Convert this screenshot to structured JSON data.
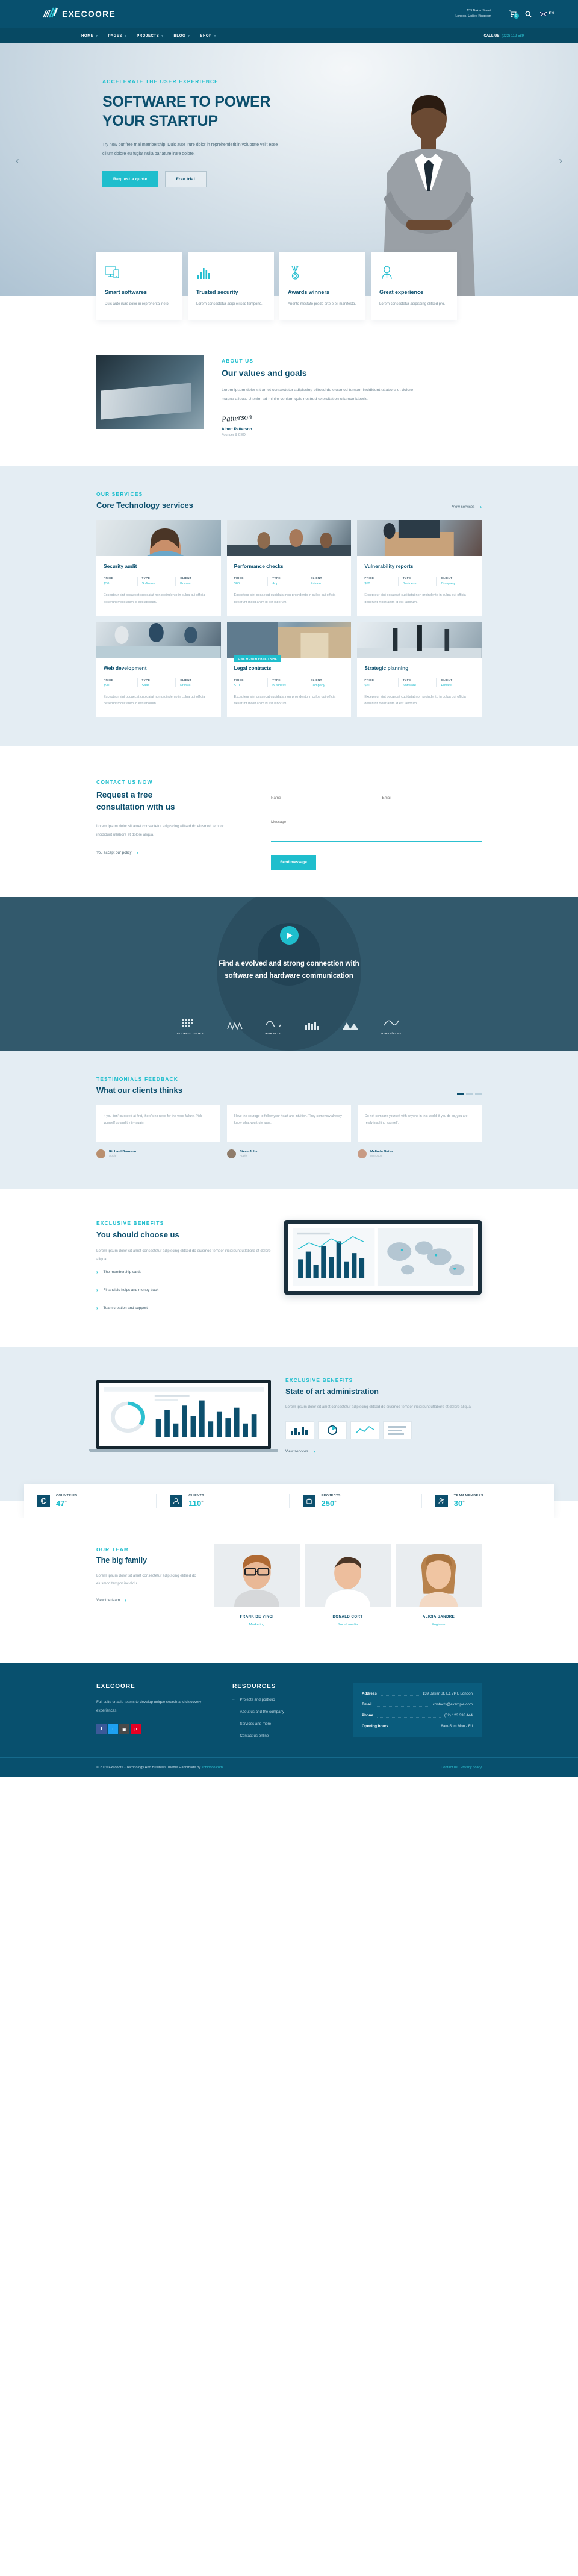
{
  "brand": {
    "name": "EXECOORE"
  },
  "topbar": {
    "address_line1": "139 Baker Street",
    "address_line2": "London, United Kingdom",
    "cart_count": "0",
    "lang": "EN",
    "cart_icon": "cart-icon",
    "search_icon": "search-icon",
    "flag_icon": "uk-flag-icon"
  },
  "nav": {
    "items": [
      {
        "label": "HOME",
        "caret": "▾"
      },
      {
        "label": "PAGES",
        "caret": "▾"
      },
      {
        "label": "PROJECTS",
        "caret": "▾"
      },
      {
        "label": "BLOG",
        "caret": "▾"
      },
      {
        "label": "SHOP",
        "caret": "▾"
      }
    ],
    "call_label": "CALL US:",
    "call_number": "(023) 112 589"
  },
  "hero": {
    "eyebrow": "ACCELERATE THE USER EXPERIENCE",
    "title_line1": "SOFTWARE TO POWER",
    "title_line2": "YOUR STARTUP",
    "paragraph": "Try now our free trial membership. Duis aute irure dolor in reprehenderit in voluptate velit esse cillum dolore eu fugiat nulla pariature irure dolore.",
    "btn_primary": "Request a quote",
    "btn_ghost": "Free trial",
    "arrow_left": "‹",
    "arrow_right": "›"
  },
  "features": [
    {
      "icon": "monitor-mobile-icon",
      "title": "Smart softwares",
      "text": "Duis aute irure dolor in repreherita ineto."
    },
    {
      "icon": "bar-chart-icon",
      "title": "Trusted security",
      "text": "Lorem consectetur adipi elitsed tempono."
    },
    {
      "icon": "medal-icon",
      "title": "Awards winners",
      "text": "Ariento mesfato prodo arte e eli manifesto."
    },
    {
      "icon": "person-tie-icon",
      "title": "Great experience",
      "text": "Lorem consectetur adipiscing elitsed pro."
    }
  ],
  "about": {
    "eyebrow": "ABOUT US",
    "title": "Our values and goals",
    "paragraph": "Lorem ipsum dolor sit amet consectetur adipiscing elitsed do eiusmod tempor incididunt utlabore et dolore magna aliqua. Utenim ad minim veniam quis nostrud exercitation ullamco laboris.",
    "signature": "Patterson",
    "name": "Albert Patterson",
    "role": "Founder & CEO"
  },
  "services": {
    "eyebrow": "OUR SERVICES",
    "title": "Core Technology services",
    "view_link": "View services",
    "chevron": "›",
    "meta_labels": {
      "price": "PRICE",
      "type": "TYPE",
      "client": "CLIENT"
    },
    "cards": [
      {
        "title": "Security audit",
        "price": "$50",
        "type": "Software",
        "client": "Private",
        "text": "Excepteur sint occaecat cupidatat non proindento in culpa qui officia deserunt mollit anim id est laborum.",
        "badge": ""
      },
      {
        "title": "Performance checks",
        "price": "$80",
        "type": "App",
        "client": "Private",
        "text": "Excepteur sint occaecat cupidatat non proindento in culpa qui officia deserunt mollit anim id est laborum.",
        "badge": ""
      },
      {
        "title": "Vulnerability reports",
        "price": "$50",
        "type": "Business",
        "client": "Company",
        "text": "Excepteur sint occaecat cupidatat non proindento in culpa qui officia deserunt mollit anim id est laborum.",
        "badge": ""
      },
      {
        "title": "Web development",
        "price": "$90",
        "type": "Saas",
        "client": "Private",
        "text": "Excepteur sint occaecat cupidatat non proindento in culpa qui officia deserunt mollit anim id est laborum.",
        "badge": ""
      },
      {
        "title": "Legal contracts",
        "price": "$100",
        "type": "Business",
        "client": "Company",
        "text": "Excepteur sint occaecat cupidatat non proindento in culpa qui officia deserunt mollit anim id est laborum.",
        "badge": "ONE MONTH FREE TRIAL"
      },
      {
        "title": "Strategic planning",
        "price": "$50",
        "type": "Software",
        "client": "Private",
        "text": "Excepteur sint occaecat cupidatat non proindento in culpa qui officia deserunt mollit anim id est laborum.",
        "badge": ""
      }
    ]
  },
  "contact": {
    "eyebrow": "CONTACT US NOW",
    "title_line1": "Request a free",
    "title_line2": "consultation with us",
    "paragraph": "Lorem ipsum dolor sit amet consectetur adipiscing elitsed do eiusmod tempor incididunt utlabore et dolore aliqua.",
    "policy": "You accept our policy",
    "chevron": "›",
    "name_placeholder": "Name",
    "email_placeholder": "Email",
    "message_placeholder": "Message",
    "send_label": "Send message"
  },
  "video": {
    "play_icon": "play-icon",
    "title_line1": "Find a evolved and strong connection with",
    "title_line2": "software and hardware communication",
    "brands": [
      {
        "icon": "grid-icon",
        "name": "TECHNOLOGIES"
      },
      {
        "icon": "peaks-icon",
        "name": ""
      },
      {
        "icon": "flow-icon",
        "name": "HOMELIS"
      },
      {
        "icon": "bars-icon",
        "name": ""
      },
      {
        "icon": "mountain-icon",
        "name": ""
      },
      {
        "icon": "wave-icon",
        "name": "Oceanforms"
      }
    ]
  },
  "testimonials": {
    "eyebrow": "TESTIMONIALS FEEDBACK",
    "title": "What our clients thinks",
    "items": [
      {
        "text": "If you don't succeed at first, there's no need for the word failure. Pick yourself up and try try again.",
        "name": "Richard Branson",
        "role": "Apple"
      },
      {
        "text": "Have the courage to follow your heart and intuition. They somehow already know what you truly want.",
        "name": "Steve Jobs",
        "role": "Apple"
      },
      {
        "text": "Do not compare yourself with anyone in this world, if you do so, you are really insulting yourself.",
        "name": "Melinda Gates",
        "role": "Microsoft"
      }
    ]
  },
  "benefits": {
    "eyebrow": "EXCLUSIVE BENEFITS",
    "title": "You should choose us",
    "paragraph": "Lorem ipsum dolor sit amet consectetur adipiscing elitsed do eiusmod tempor incididunt utlabore et dolore aliqua.",
    "chevron": "›",
    "items": [
      "The membership cards",
      "Financials helps and money back",
      "Team creation and support"
    ]
  },
  "admin": {
    "eyebrow": "EXCLUSIVE BENEFITS",
    "title": "State of art administration",
    "paragraph": "Lorem ipsum dolor sit amet consectetur adipiscing elitsed do eiusmod tempor incididunt utlabore et dolore aliqua.",
    "view_link": "View services",
    "chevron": "›"
  },
  "counters": [
    {
      "icon": "globe-icon",
      "label": "COUNTRIES",
      "value": "47",
      "suffix": "+"
    },
    {
      "icon": "user-icon",
      "label": "CLIENTS",
      "value": "110",
      "suffix": "+"
    },
    {
      "icon": "briefcase-icon",
      "label": "PROJECTS",
      "value": "250",
      "suffix": "+"
    },
    {
      "icon": "team-icon",
      "label": "TEAM MEMBERS",
      "value": "30",
      "suffix": "+"
    }
  ],
  "team": {
    "eyebrow": "OUR TEAM",
    "title": "The big family",
    "paragraph": "Lorem ipsum dolor sit amet consectetur adipiscing elitsed do eiusmod tempor incididu.",
    "link": "View the team",
    "chevron": "›",
    "members": [
      {
        "name": "FRANK DE VINCI",
        "role": "Marketing"
      },
      {
        "name": "DONALD CORT",
        "role": "Social media"
      },
      {
        "name": "ALICIA SANDRE",
        "role": "Engineer"
      }
    ]
  },
  "footer": {
    "brand": "EXECOORE",
    "brand_text": "Full suite enable teams to develop unique search and discovery experiences.",
    "socials": [
      {
        "icon": "facebook-icon",
        "glyph": "f",
        "color": "#3b5998"
      },
      {
        "icon": "twitter-icon",
        "glyph": "t",
        "color": "#1da1f2"
      },
      {
        "icon": "instagram-icon",
        "glyph": "▣",
        "color": "#4a4a4a"
      },
      {
        "icon": "pinterest-icon",
        "glyph": "p",
        "color": "#e60023"
      }
    ],
    "resources_title": "RESOURCES",
    "resources": [
      "Projects and portfolio",
      "About us and the company",
      "Services and more",
      "Contact us online"
    ],
    "info": [
      {
        "k": "Address",
        "v": "139 Baker St, E1 7PT, London"
      },
      {
        "k": "Email",
        "v": "contacts@example.com"
      },
      {
        "k": "Phone",
        "v": "(02) 123 333 444"
      },
      {
        "k": "Opening hours",
        "v": "8am-5pm Mon - Fri"
      }
    ],
    "copyright_pre": "© 2019 Execoore - Technology And Business Theme Handmade by ",
    "copyright_link": "schiocco.com",
    "copyright_post": ".",
    "bottom_link1": "Contact us",
    "bottom_sep": " | ",
    "bottom_link2": "Privacy policy"
  }
}
